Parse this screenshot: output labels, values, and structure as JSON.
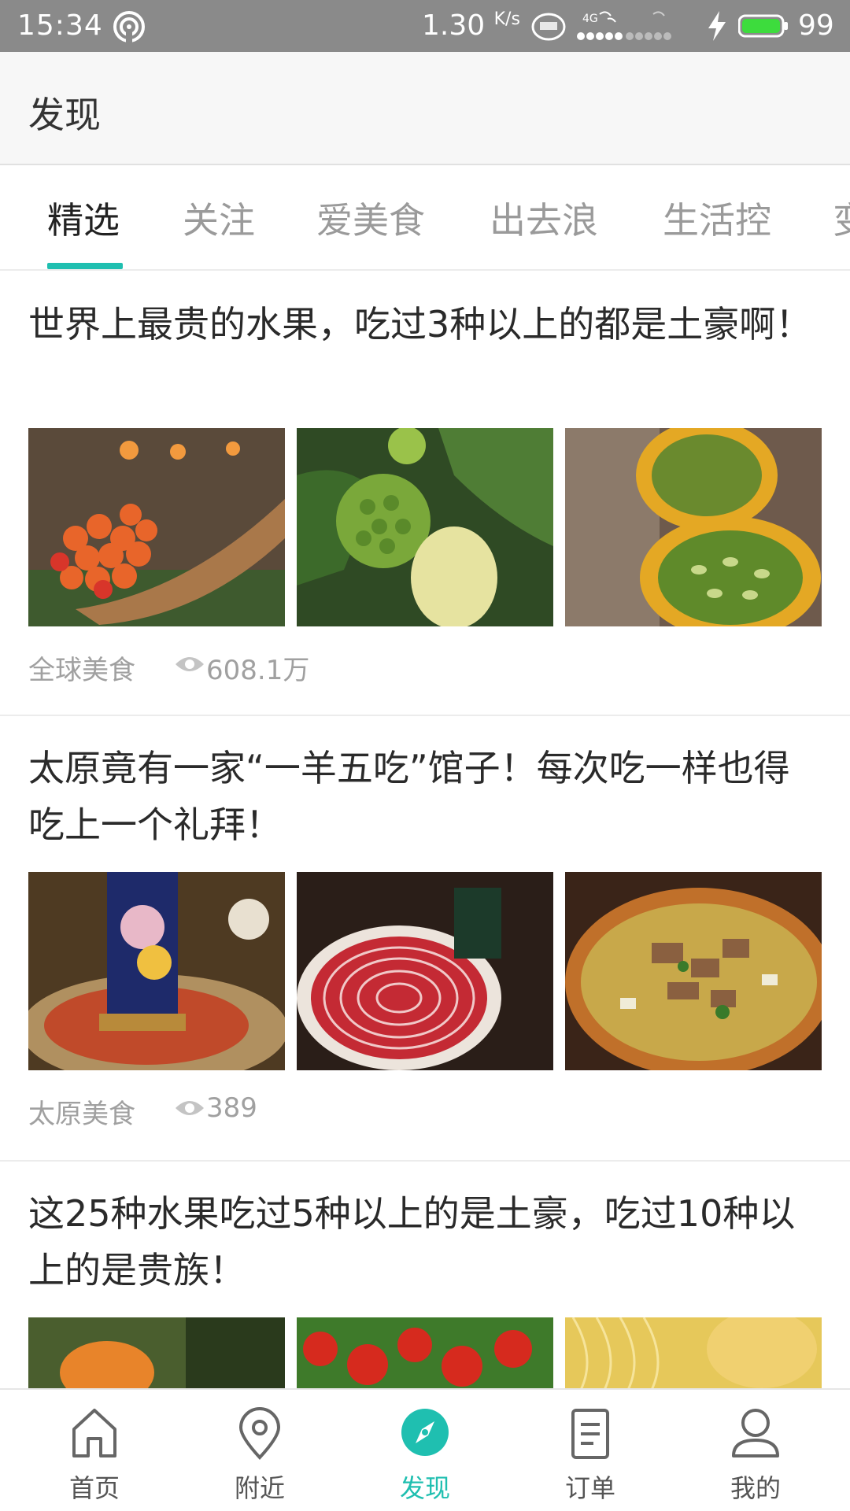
{
  "status_bar": {
    "time": "15:34",
    "speed": "1.30",
    "speed_unit": "K/s",
    "net1": "4G",
    "battery": "99",
    "colors": {
      "bg": "#8a8a8a",
      "battery_fill": "#3ddc3d"
    }
  },
  "header": {
    "title": "发现"
  },
  "tabs": {
    "items": [
      {
        "label": "精选",
        "active": true
      },
      {
        "label": "关注"
      },
      {
        "label": "爱美食"
      },
      {
        "label": "出去浪"
      },
      {
        "label": "生活控"
      },
      {
        "label": "变"
      }
    ],
    "accent": "#1fbfb0"
  },
  "feed": {
    "cards": [
      {
        "headline": "世界上最贵的水果，吃过3种以上的都是土豪啊！",
        "source": "全球美食",
        "views": "608.1万",
        "images": [
          "cloudberries-image",
          "noni-fruit-image",
          "horned-melon-image"
        ]
      },
      {
        "headline": "太原竟有一家“一羊五吃”馆子！每次吃一样也得吃上一个礼拜！",
        "source": "太原美食",
        "views": "389",
        "images": [
          "hotpot-image",
          "mutton-slices-image",
          "lamb-soup-image"
        ]
      },
      {
        "headline": "这25种水果吃过5种以上的是土豪，吃过10种以上的是贵族！",
        "images": [
          "orange-fruit-image",
          "red-fruits-image",
          "yellow-noodle-fruit-image"
        ]
      }
    ]
  },
  "bottom_nav": {
    "items": [
      {
        "label": "首页",
        "icon": "home-icon"
      },
      {
        "label": "附近",
        "icon": "location-pin-icon"
      },
      {
        "label": "发现",
        "icon": "compass-icon",
        "active": true
      },
      {
        "label": "订单",
        "icon": "order-list-icon"
      },
      {
        "label": "我的",
        "icon": "user-icon"
      }
    ]
  }
}
